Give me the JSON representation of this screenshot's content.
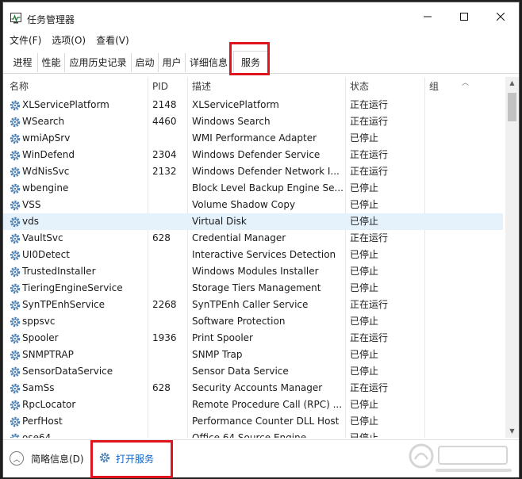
{
  "window": {
    "title": "任务管理器"
  },
  "menu": [
    "文件(F)",
    "选项(O)",
    "查看(V)"
  ],
  "tabs": [
    "进程",
    "性能",
    "应用历史记录",
    "启动",
    "用户",
    "详细信息",
    "服务"
  ],
  "active_tab": "服务",
  "columns": {
    "name": "名称",
    "pid": "PID",
    "desc": "描述",
    "status": "状态",
    "group": "组"
  },
  "rows": [
    {
      "name": "XLServicePlatform",
      "pid": "2148",
      "desc": "XLServicePlatform",
      "status": "正在运行"
    },
    {
      "name": "WSearch",
      "pid": "4460",
      "desc": "Windows Search",
      "status": "正在运行"
    },
    {
      "name": "wmiApSrv",
      "pid": "",
      "desc": "WMI Performance Adapter",
      "status": "已停止"
    },
    {
      "name": "WinDefend",
      "pid": "2304",
      "desc": "Windows Defender Service",
      "status": "正在运行"
    },
    {
      "name": "WdNisSvc",
      "pid": "2132",
      "desc": "Windows Defender Network I...",
      "status": "正在运行"
    },
    {
      "name": "wbengine",
      "pid": "",
      "desc": "Block Level Backup Engine Se...",
      "status": "已停止"
    },
    {
      "name": "VSS",
      "pid": "",
      "desc": "Volume Shadow Copy",
      "status": "已停止"
    },
    {
      "name": "vds",
      "pid": "",
      "desc": "Virtual Disk",
      "status": "已停止"
    },
    {
      "name": "VaultSvc",
      "pid": "628",
      "desc": "Credential Manager",
      "status": "正在运行"
    },
    {
      "name": "UI0Detect",
      "pid": "",
      "desc": "Interactive Services Detection",
      "status": "已停止"
    },
    {
      "name": "TrustedInstaller",
      "pid": "",
      "desc": "Windows Modules Installer",
      "status": "已停止"
    },
    {
      "name": "TieringEngineService",
      "pid": "",
      "desc": "Storage Tiers Management",
      "status": "已停止"
    },
    {
      "name": "SynTPEnhService",
      "pid": "2268",
      "desc": "SynTPEnh Caller Service",
      "status": "正在运行"
    },
    {
      "name": "sppsvc",
      "pid": "",
      "desc": "Software Protection",
      "status": "已停止"
    },
    {
      "name": "Spooler",
      "pid": "1936",
      "desc": "Print Spooler",
      "status": "正在运行"
    },
    {
      "name": "SNMPTRAP",
      "pid": "",
      "desc": "SNMP Trap",
      "status": "已停止"
    },
    {
      "name": "SensorDataService",
      "pid": "",
      "desc": "Sensor Data Service",
      "status": "已停止"
    },
    {
      "name": "SamSs",
      "pid": "628",
      "desc": "Security Accounts Manager",
      "status": "正在运行"
    },
    {
      "name": "RpcLocator",
      "pid": "",
      "desc": "Remote Procedure Call (RPC) ...",
      "status": "已停止"
    },
    {
      "name": "PerfHost",
      "pid": "",
      "desc": "Performance Counter DLL Host",
      "status": "已停止"
    },
    {
      "name": "ose64",
      "pid": "",
      "desc": "Office 64 Source Engine",
      "status": "已停止"
    }
  ],
  "selected_row": "vds",
  "footer": {
    "fewer_details": "简略信息(D)",
    "open_services": "打开服务"
  },
  "icons": {
    "service": "gear-icon",
    "app": "task-manager-icon"
  },
  "colors": {
    "highlight_box": "#e0141e",
    "selected_row": "#e5f1fb",
    "link": "#0a63c9"
  }
}
